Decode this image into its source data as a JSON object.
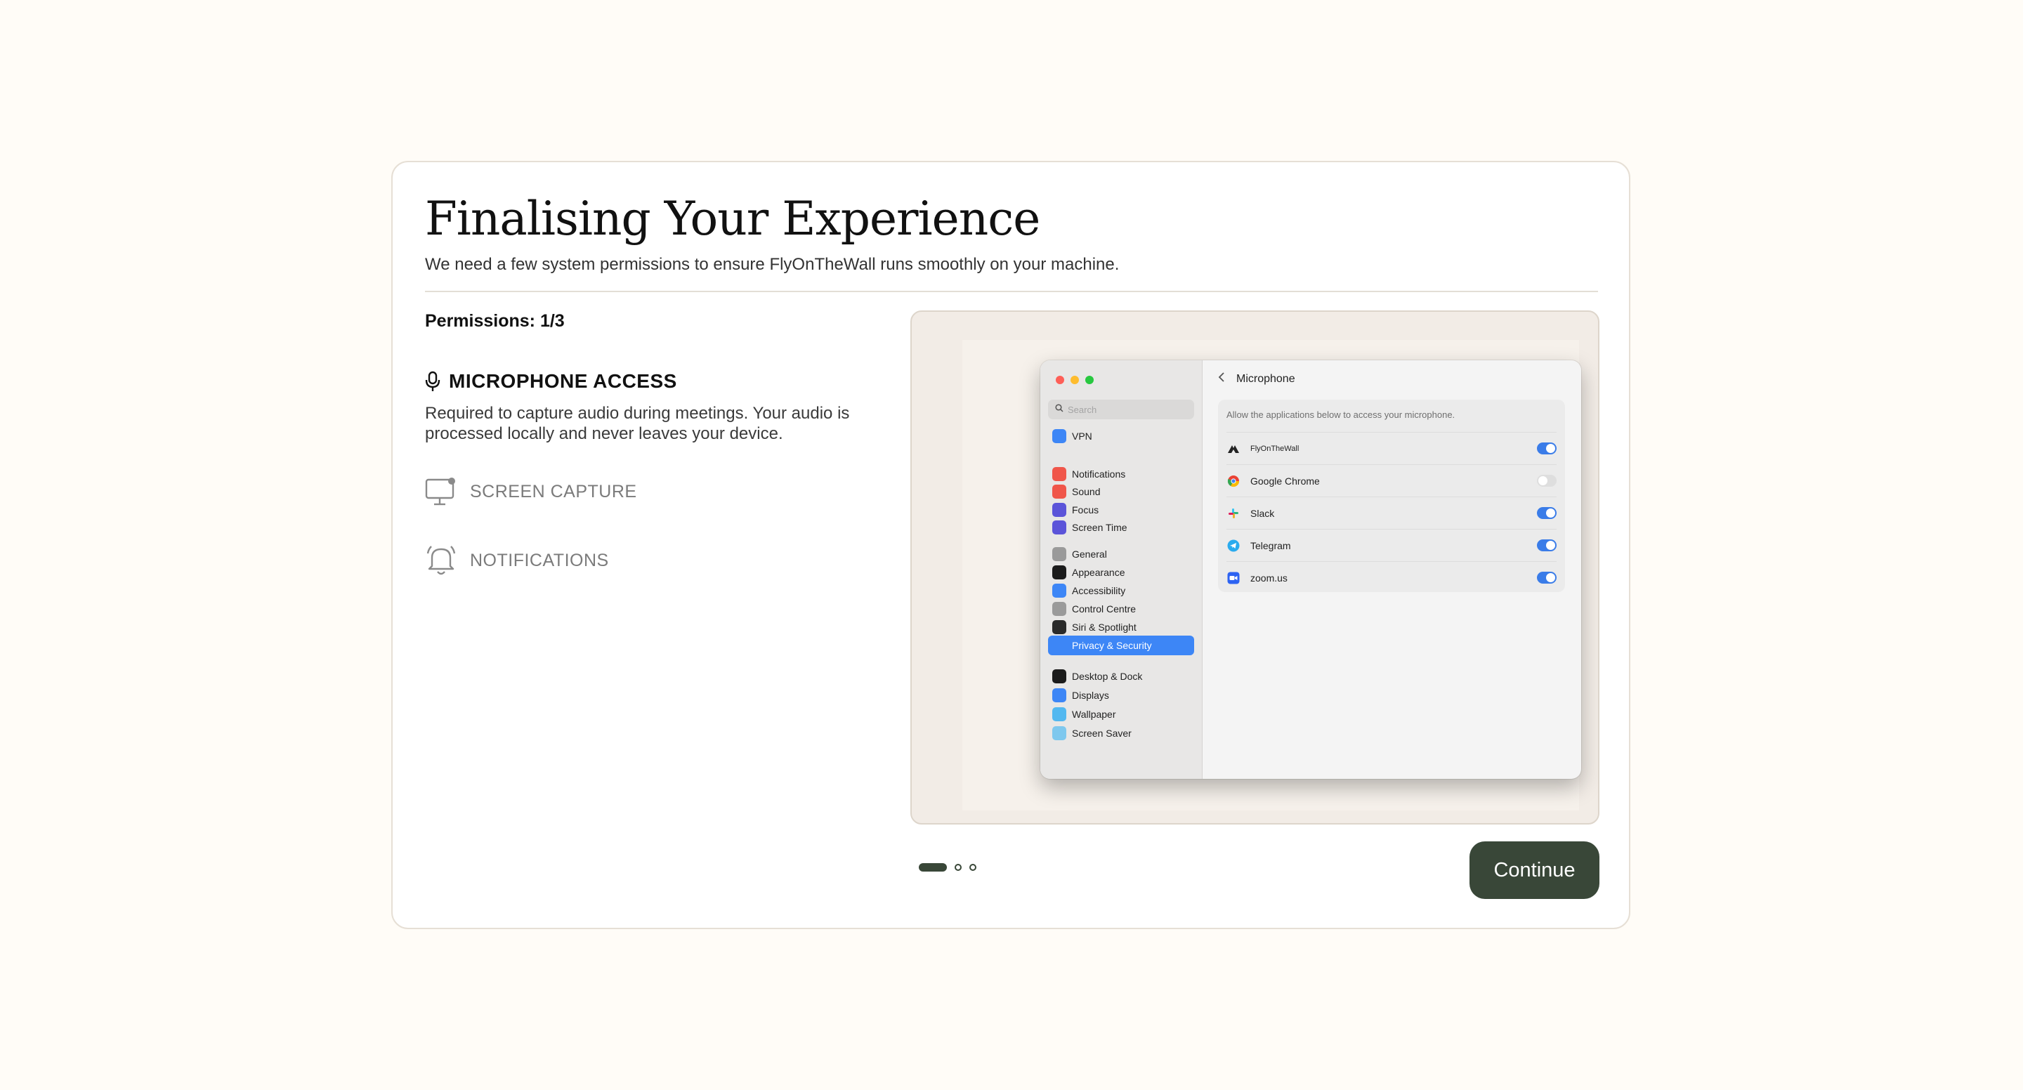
{
  "header": {
    "title": "Finalising Your Experience",
    "subtitle": "We need a few system permissions to ensure FlyOnTheWall runs smoothly on your machine."
  },
  "permissions": {
    "counter": "Permissions: 1/3",
    "active": {
      "label": "MICROPHONE ACCESS",
      "icon": "microphone-icon",
      "description": "Required to capture audio during meetings. Your audio is processed locally and never leaves your device."
    },
    "pending": [
      {
        "label": "SCREEN CAPTURE",
        "icon": "monitor-icon"
      },
      {
        "label": "NOTIFICATIONS",
        "icon": "bell-icon"
      }
    ]
  },
  "preview": {
    "search_placeholder": "Search",
    "sidebar": [
      {
        "label": "VPN",
        "color": "#3d86f6"
      },
      {
        "label": "Notifications",
        "color": "#f0564a"
      },
      {
        "label": "Sound",
        "color": "#f0564a"
      },
      {
        "label": "Focus",
        "color": "#5b54d9"
      },
      {
        "label": "Screen Time",
        "color": "#5b54d9"
      },
      {
        "label": "General",
        "color": "#9a9a9a"
      },
      {
        "label": "Appearance",
        "color": "#1b1b1b"
      },
      {
        "label": "Accessibility",
        "color": "#3d86f6"
      },
      {
        "label": "Control Centre",
        "color": "#9a9a9a"
      },
      {
        "label": "Siri & Spotlight",
        "color": "#2a2a2a"
      },
      {
        "label": "Privacy & Security",
        "color": "#3d86f6"
      },
      {
        "label": "Desktop & Dock",
        "color": "#1b1b1b"
      },
      {
        "label": "Displays",
        "color": "#3d86f6"
      },
      {
        "label": "Wallpaper",
        "color": "#52b8f0"
      },
      {
        "label": "Screen Saver",
        "color": "#7ec8ee"
      }
    ],
    "active_item": "Privacy & Security",
    "pane_title": "Microphone",
    "pane_description": "Allow the applications below to access your microphone.",
    "apps": [
      {
        "name": "FlyOnTheWall",
        "enabled": true
      },
      {
        "name": "Google Chrome",
        "enabled": false
      },
      {
        "name": "Slack",
        "enabled": true
      },
      {
        "name": "Telegram",
        "enabled": true
      },
      {
        "name": "zoom.us",
        "enabled": true
      }
    ]
  },
  "pagination": {
    "current": 1,
    "total": 3
  },
  "actions": {
    "continue_label": "Continue"
  },
  "colors": {
    "accent": "#394738",
    "background": "#fffcf7",
    "toggle_on": "#3a7ce8"
  }
}
